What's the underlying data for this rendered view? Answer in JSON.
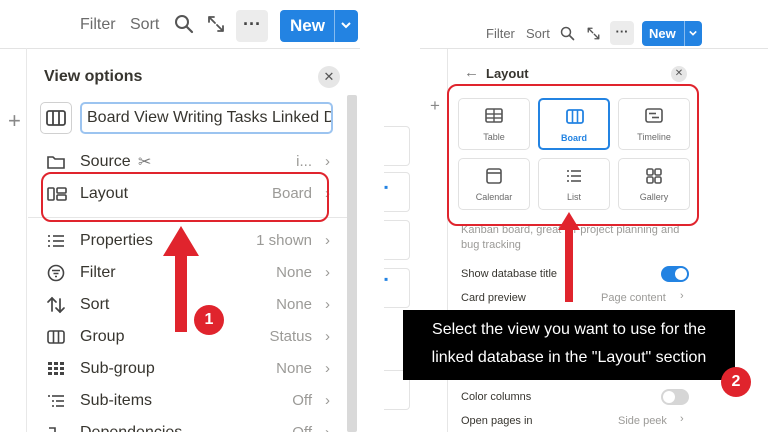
{
  "left": {
    "toolbar": {
      "filter": "Filter",
      "sort": "Sort",
      "more": "···",
      "new": "New"
    },
    "panel": {
      "title": "View options",
      "name_value": "Board View Writing Tasks Linked D",
      "rows": [
        {
          "label": "Source",
          "value": "i..."
        },
        {
          "label": "Layout",
          "value": "Board"
        },
        {
          "label": "Properties",
          "value": "1 shown"
        },
        {
          "label": "Filter",
          "value": "None"
        },
        {
          "label": "Sort",
          "value": "None"
        },
        {
          "label": "Group",
          "value": "Status"
        },
        {
          "label": "Sub-group",
          "value": "None"
        },
        {
          "label": "Sub-items",
          "value": "Off"
        },
        {
          "label": "Dependencies",
          "value": "Off"
        }
      ]
    }
  },
  "right": {
    "toolbar": {
      "filter": "Filter",
      "sort": "Sort",
      "more": "···",
      "new": "New"
    },
    "panel": {
      "title": "Layout",
      "tiles": [
        {
          "label": "Table",
          "icon": "table-icon",
          "selected": false
        },
        {
          "label": "Board",
          "icon": "board-icon",
          "selected": true
        },
        {
          "label": "Timeline",
          "icon": "timeline-icon",
          "selected": false
        },
        {
          "label": "Calendar",
          "icon": "calendar-icon",
          "selected": false
        },
        {
          "label": "List",
          "icon": "list-icon",
          "selected": false
        },
        {
          "label": "Gallery",
          "icon": "gallery-icon",
          "selected": false
        }
      ],
      "description_line1": "Kanban board, great for project planning and",
      "description_line2": "bug tracking",
      "show_title_label": "Show database title",
      "show_title_on": true,
      "card_preview_label": "Card preview",
      "card_preview_value": "Page content",
      "color_columns_label": "Color columns",
      "color_columns_on": false,
      "open_pages_label": "Open pages in",
      "open_pages_value": "Side peek"
    }
  },
  "annotations": {
    "badge1": "1",
    "badge2": "2",
    "callout_line1": "Select the view you want to use for the",
    "callout_line2": "linked database in the \"Layout\" section"
  },
  "colors": {
    "accent": "#2383e2",
    "highlight": "#e0242d"
  }
}
